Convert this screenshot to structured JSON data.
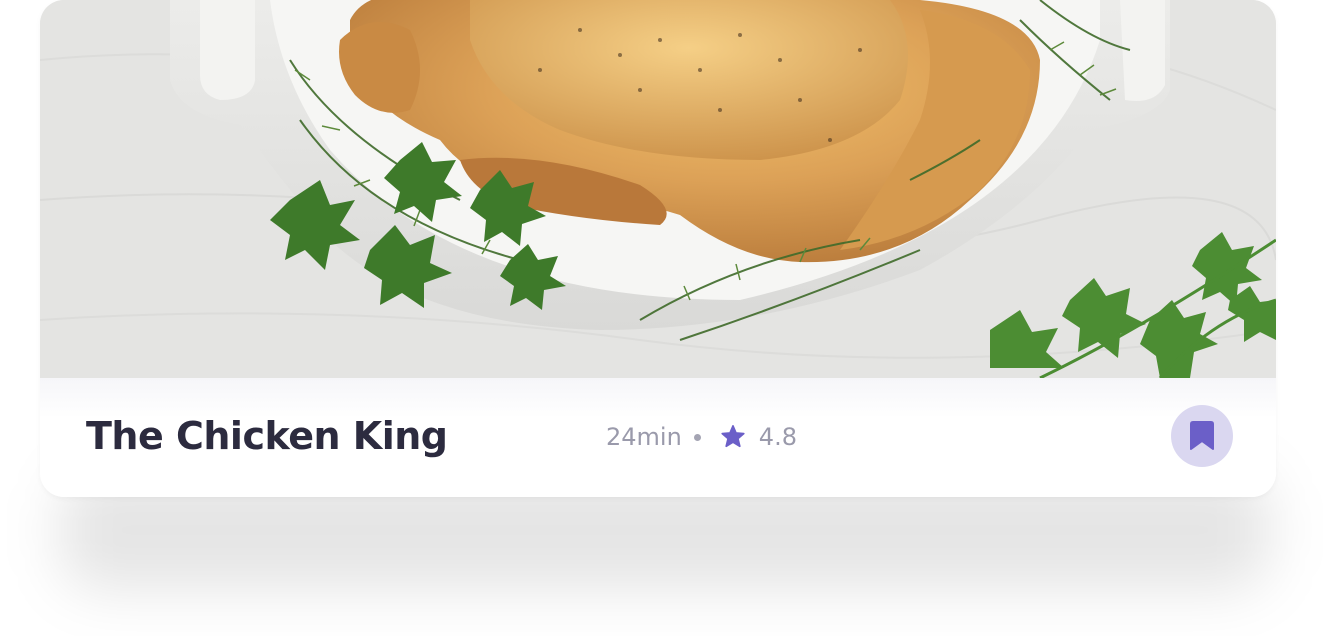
{
  "recipe_card": {
    "title": "The Chicken King",
    "duration": "24min",
    "rating": "4.8",
    "image_alt": "Roast chicken in a white dish with fresh herbs",
    "icons": {
      "rating": "star-icon",
      "save": "bookmark-icon"
    },
    "colors": {
      "accent": "#6b5fc8",
      "bookmark_bg": "#dad7f0",
      "title": "#2c2b3f",
      "meta_text": "#9a9aab"
    }
  }
}
